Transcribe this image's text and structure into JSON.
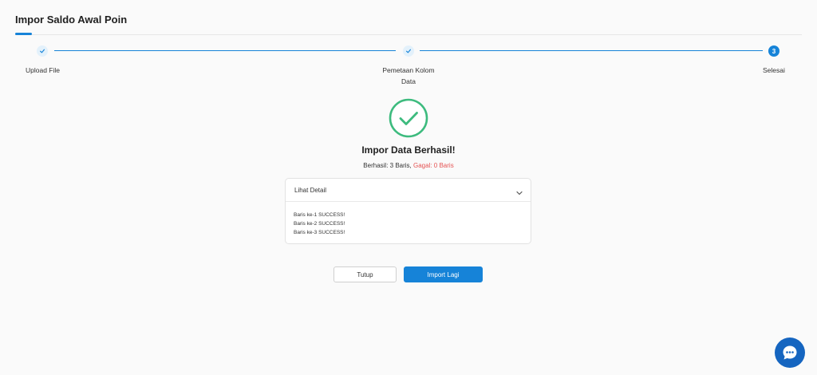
{
  "header": {
    "title": "Impor Saldo Awal Poin"
  },
  "stepper": {
    "steps": [
      {
        "label_line1": "Upload File",
        "label_line2": "",
        "number": "",
        "state": "done"
      },
      {
        "label_line1": "Pemetaan Kolom",
        "label_line2": "Data",
        "number": "",
        "state": "done"
      },
      {
        "label_line1": "Selesai",
        "label_line2": "",
        "number": "3",
        "state": "active"
      }
    ]
  },
  "result": {
    "title": "Impor Data Berhasil!",
    "success_text": "Berhasil: 3 Baris,",
    "fail_text": "Gagal: 0 Baris"
  },
  "detail": {
    "title": "Lihat Detail",
    "lines": [
      "Baris ke-1 SUCCESS!",
      "Baris ke-2 SUCCESS!",
      "Baris ke-3 SUCCESS!"
    ]
  },
  "actions": {
    "close_label": "Tutup",
    "import_label": "Import Lagi"
  },
  "colors": {
    "primary": "#1683d8",
    "success": "#3dbb7e",
    "danger": "#e55353"
  }
}
